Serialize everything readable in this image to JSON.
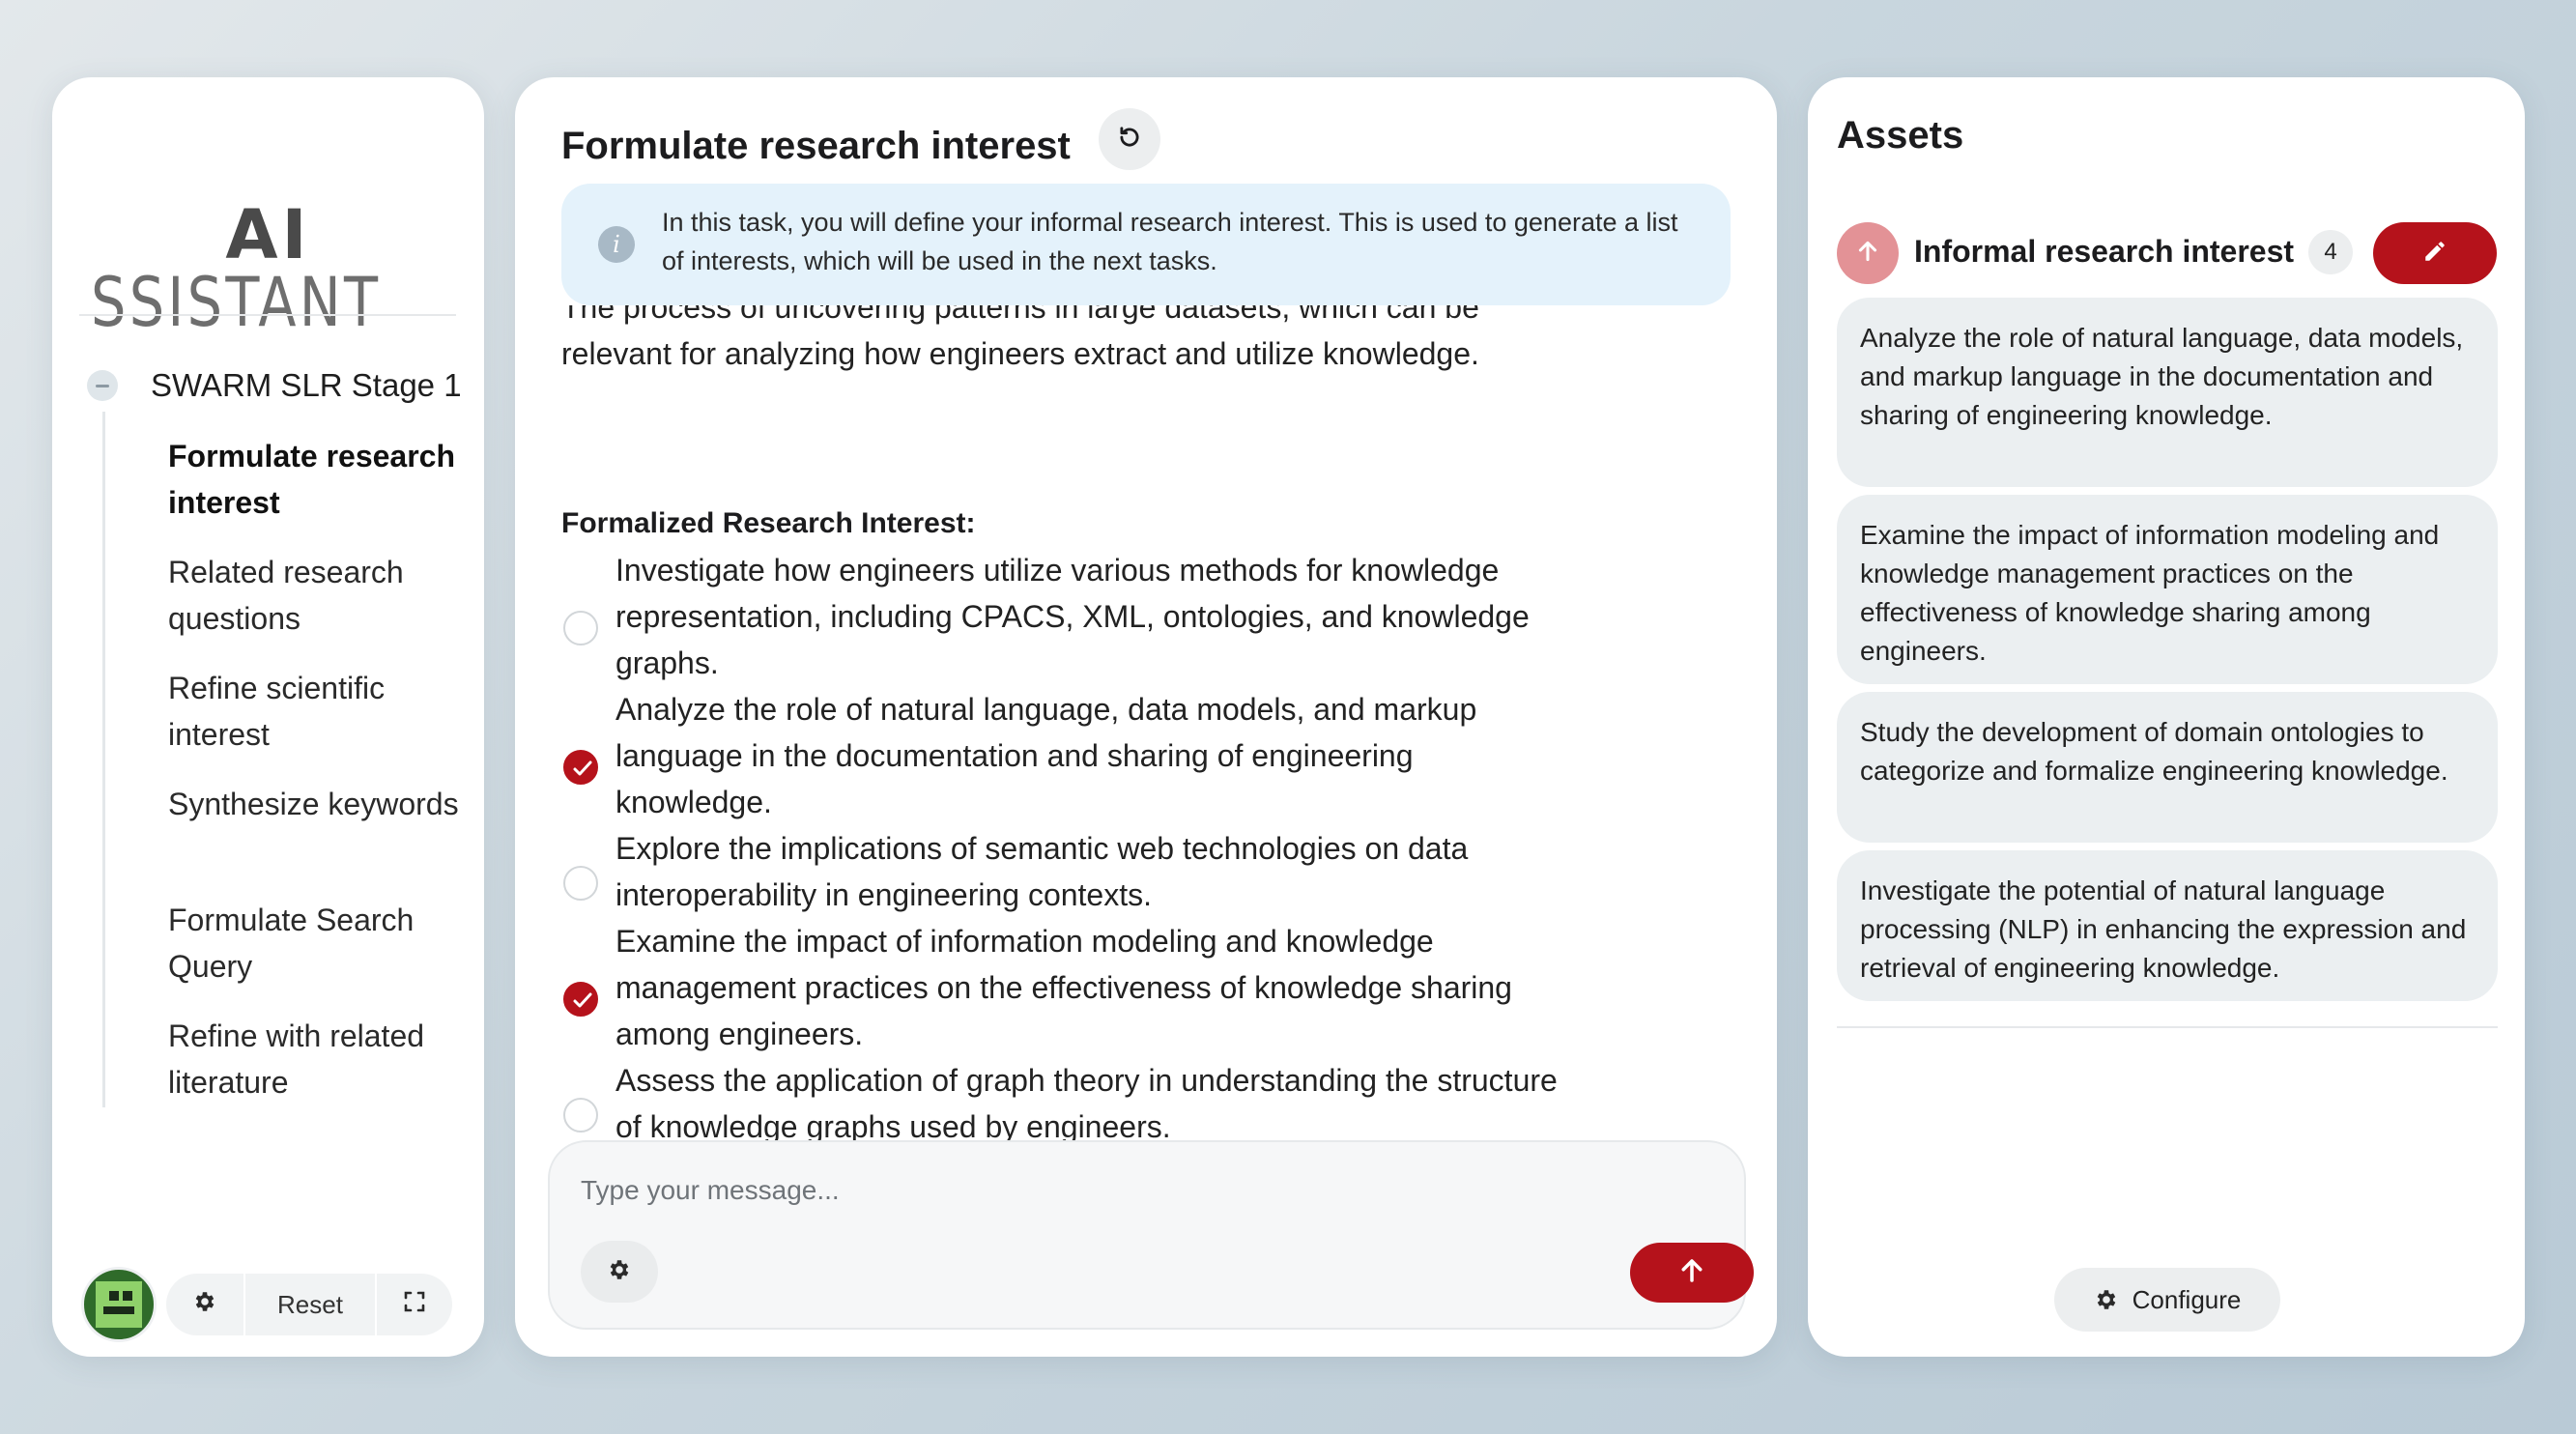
{
  "sidebar": {
    "logo_bold": "AI",
    "logo_rest": "SSISTANT",
    "stage": "SWARM SLR Stage 1",
    "items": [
      {
        "label": "Formulate research interest",
        "active": true
      },
      {
        "label": "Related research questions",
        "active": false
      },
      {
        "label": "Refine scientific interest",
        "active": false
      },
      {
        "label": "Synthesize keywords",
        "active": false
      },
      {
        "label": "Formulate Search Query",
        "active": false
      },
      {
        "label": "Refine with related literature",
        "active": false
      }
    ],
    "footer": {
      "reset_label": "Reset",
      "icons": [
        "avatar",
        "gear-icon",
        "fullscreen-icon"
      ]
    }
  },
  "main": {
    "title": "Formulate research interest",
    "refresh_icon": "refresh-icon",
    "info_icon": "info-icon",
    "info_text": "In this task, you will define your informal research interest. This is used to generate a list of interests, which will be used in the next tasks.",
    "paragraph": "The process of uncovering patterns in large datasets, which can be relevant for analyzing how engineers extract and utilize knowledge.",
    "subheading": "Formalized Research Interest:",
    "options": [
      {
        "text": "Investigate how engineers utilize various methods for knowledge representation, including CPACS, XML, ontologies, and knowledge graphs.",
        "checked": false
      },
      {
        "text": "Analyze the role of natural language, data models, and markup language in the documentation and sharing of engineering knowledge.",
        "checked": true
      },
      {
        "text": "Explore the implications of semantic web technologies on data interoperability in engineering contexts.",
        "checked": false
      },
      {
        "text": "Examine the impact of information modeling and knowledge management practices on the effectiveness of knowledge sharing among engineers.",
        "checked": true
      },
      {
        "text": "Assess the application of graph theory in understanding the structure of knowledge graphs used by engineers.",
        "checked": false
      }
    ],
    "composer": {
      "placeholder": "Type your message...",
      "value": "",
      "icons": [
        "gear-icon",
        "send-arrow-icon"
      ]
    }
  },
  "assets": {
    "title": "Assets",
    "section_label": "Informal research interest",
    "count": "4",
    "icons": [
      "arrow-up-icon",
      "edit-pencil-icon"
    ],
    "items": [
      "Analyze the role of natural language, data models, and markup language in the documentation and sharing of engineering knowledge.",
      "Examine the impact of information modeling and knowledge management practices on the effectiveness of knowledge sharing among engineers.",
      "Study the development of domain ontologies to categorize and formalize engineering knowledge.",
      "Investigate the potential of natural language processing (NLP) in enhancing the expression and retrieval of engineering knowledge."
    ],
    "configure_label": "Configure"
  },
  "colors": {
    "accent": "#b5121b",
    "accent_light": "#e39296",
    "info_bg": "#e4f2fb",
    "card_bg": "#ebeff1"
  }
}
